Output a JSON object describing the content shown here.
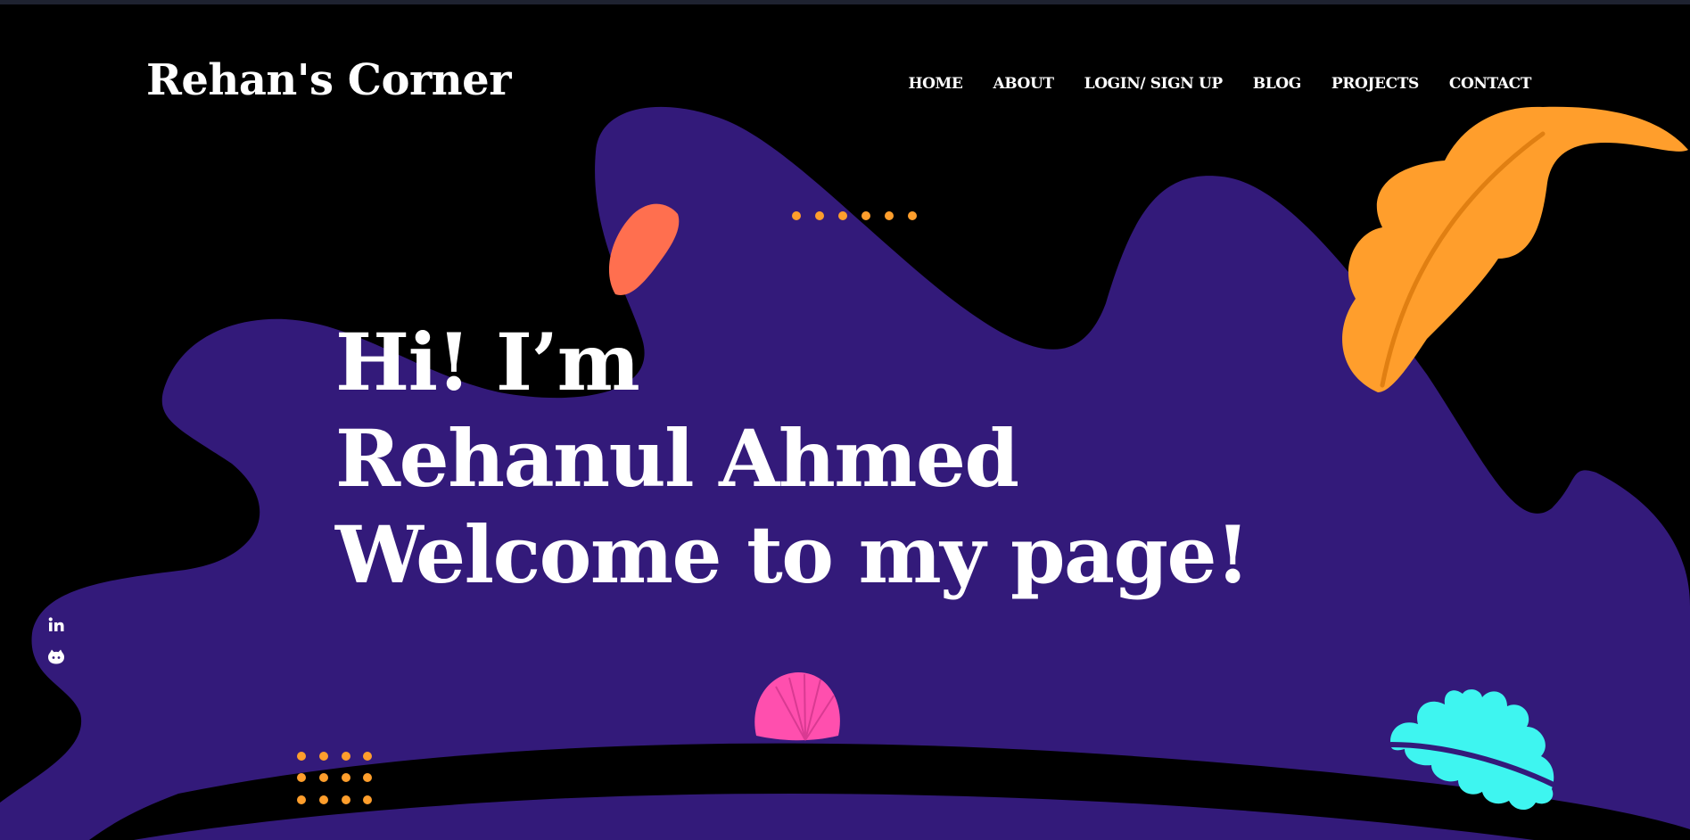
{
  "site": {
    "logo": "Rehan's Corner"
  },
  "nav": {
    "items": [
      "HOME",
      "ABOUT",
      "LOGIN/ SIGN UP",
      "BLOG",
      "PROJECTS",
      "CONTACT"
    ]
  },
  "hero": {
    "line1": "Hi! I’m",
    "line2": "Rehanul Ahmed",
    "line3": "Welcome to my page!"
  },
  "social": {
    "icons": [
      "linkedin-icon",
      "github-icon"
    ]
  },
  "colors": {
    "background": "#000000",
    "blob": "#331a7a",
    "orange_leaf": "#ff9e2c",
    "coral_leaf": "#ff6f4f",
    "pink_shell": "#ff4fae",
    "cyan_leaf": "#3ef5f0",
    "dots": "#ff9e2c",
    "text": "#ffffff"
  }
}
